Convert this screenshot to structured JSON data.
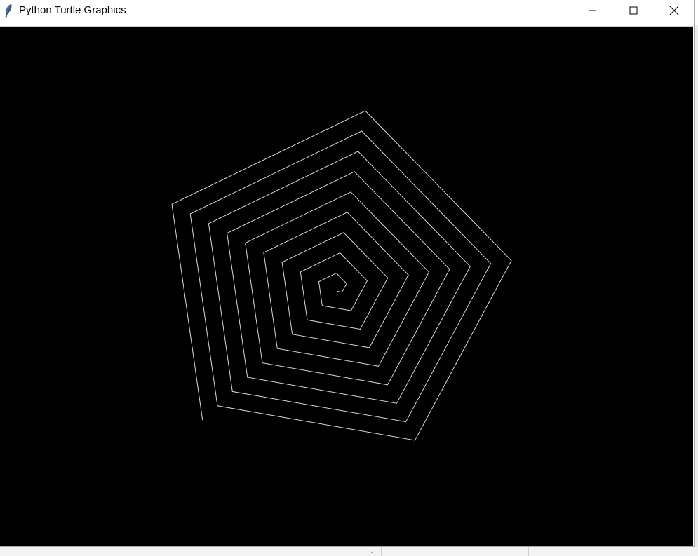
{
  "window": {
    "title": "Python Turtle Graphics",
    "app_icon": "feather-icon",
    "controls": {
      "minimize_icon": "minimize-icon",
      "maximize_icon": "maximize-icon",
      "close_icon": "close-icon"
    }
  },
  "canvas": {
    "background_color": "#000000",
    "pen_color": "#d8d8d8",
    "drawing": {
      "shape": "pentagon spiral",
      "turn_angle_degrees": 72,
      "loops": 9
    }
  },
  "colors": {
    "titlebar": "#ffffff",
    "canvas_bg": "#000000",
    "pen": "#d8d8d8"
  }
}
